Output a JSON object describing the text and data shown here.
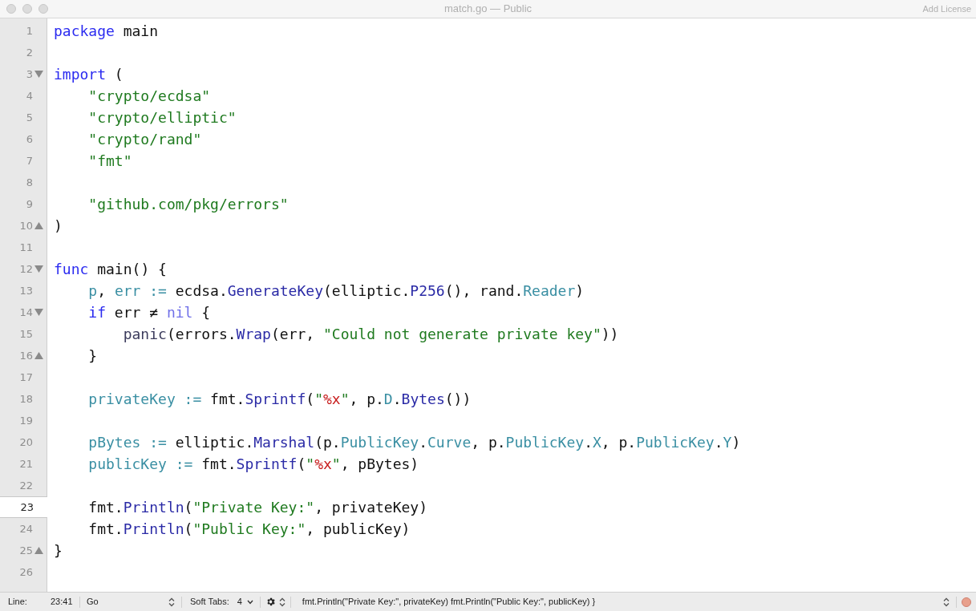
{
  "window": {
    "title": "match.go — Public",
    "action": "Add License"
  },
  "editor": {
    "lines": [
      {
        "number": "1",
        "fold_start": false,
        "fold_end": false,
        "current": false,
        "tokens": [
          {
            "kind": "keyword",
            "text": "package"
          },
          {
            "kind": "plain",
            "text": " main"
          }
        ]
      },
      {
        "number": "2",
        "fold_start": false,
        "fold_end": false,
        "current": false
      },
      {
        "number": "3",
        "fold_start": true,
        "fold_end": false,
        "current": false,
        "tokens": [
          {
            "kind": "keyword",
            "text": "import"
          },
          {
            "kind": "plain",
            "text": " ("
          }
        ]
      },
      {
        "number": "4",
        "fold_start": false,
        "fold_end": false,
        "current": false,
        "tokens": [
          {
            "kind": "string",
            "text": "    \"crypto/ecdsa\""
          }
        ]
      },
      {
        "number": "5",
        "fold_start": false,
        "fold_end": false,
        "current": false,
        "tokens": [
          {
            "kind": "string",
            "text": "    \"crypto/elliptic\""
          }
        ]
      },
      {
        "number": "6",
        "fold_start": false,
        "fold_end": false,
        "current": false,
        "tokens": [
          {
            "kind": "string",
            "text": "    \"crypto/rand\""
          }
        ]
      },
      {
        "number": "7",
        "fold_start": false,
        "fold_end": false,
        "current": false,
        "tokens": [
          {
            "kind": "string",
            "text": "    \"fmt\""
          }
        ]
      },
      {
        "number": "8",
        "fold_start": false,
        "fold_end": false,
        "current": false
      },
      {
        "number": "9",
        "fold_start": false,
        "fold_end": false,
        "current": false,
        "tokens": [
          {
            "kind": "string",
            "text": "    \"github.com/pkg/errors\""
          }
        ]
      },
      {
        "number": "10",
        "fold_start": false,
        "fold_end": true,
        "current": false,
        "tokens": [
          {
            "kind": "plain",
            "text": ")"
          }
        ]
      },
      {
        "number": "11",
        "fold_start": false,
        "fold_end": false,
        "current": false
      },
      {
        "number": "12",
        "fold_start": true,
        "fold_end": false,
        "current": false,
        "tokens": [
          {
            "kind": "keyword",
            "text": "func"
          },
          {
            "kind": "plain",
            "text": " main() {"
          }
        ]
      },
      {
        "number": "13",
        "fold_start": false,
        "fold_end": false,
        "current": false,
        "tokens": [
          {
            "kind": "variable",
            "text": "    p"
          },
          {
            "kind": "plain",
            "text": ", "
          },
          {
            "kind": "variable",
            "text": "err :="
          },
          {
            "kind": "plain",
            "text": " ecdsa."
          },
          {
            "kind": "method",
            "text": "GenerateKey"
          },
          {
            "kind": "plain",
            "text": "(elliptic."
          },
          {
            "kind": "method",
            "text": "P256"
          },
          {
            "kind": "plain",
            "text": "(), rand."
          },
          {
            "kind": "field",
            "text": "Reader"
          },
          {
            "kind": "plain",
            "text": ")"
          }
        ]
      },
      {
        "number": "14",
        "fold_start": true,
        "fold_end": false,
        "current": false,
        "tokens": [
          {
            "kind": "keyword",
            "text": "    if"
          },
          {
            "kind": "plain",
            "text": " err ≠ "
          },
          {
            "kind": "constant",
            "text": "nil"
          },
          {
            "kind": "plain",
            "text": " {"
          }
        ]
      },
      {
        "number": "15",
        "fold_start": false,
        "fold_end": false,
        "current": false,
        "tokens": [
          {
            "kind": "builtin",
            "text": "        panic"
          },
          {
            "kind": "plain",
            "text": "(errors."
          },
          {
            "kind": "method",
            "text": "Wrap"
          },
          {
            "kind": "plain",
            "text": "(err, "
          },
          {
            "kind": "string",
            "text": "\"Could not generate private key\""
          },
          {
            "kind": "plain",
            "text": "))"
          }
        ]
      },
      {
        "number": "16",
        "fold_start": false,
        "fold_end": true,
        "current": false,
        "tokens": [
          {
            "kind": "plain",
            "text": "    }"
          }
        ]
      },
      {
        "number": "17",
        "fold_start": false,
        "fold_end": false,
        "current": false
      },
      {
        "number": "18",
        "fold_start": false,
        "fold_end": false,
        "current": false,
        "tokens": [
          {
            "kind": "variable",
            "text": "    privateKey :="
          },
          {
            "kind": "plain",
            "text": " fmt."
          },
          {
            "kind": "method",
            "text": "Sprintf"
          },
          {
            "kind": "plain",
            "text": "("
          },
          {
            "kind": "string",
            "text": "\""
          },
          {
            "kind": "format",
            "text": "%x"
          },
          {
            "kind": "string",
            "text": "\""
          },
          {
            "kind": "plain",
            "text": ", p."
          },
          {
            "kind": "field",
            "text": "D"
          },
          {
            "kind": "plain",
            "text": "."
          },
          {
            "kind": "method",
            "text": "Bytes"
          },
          {
            "kind": "plain",
            "text": "())"
          }
        ]
      },
      {
        "number": "19",
        "fold_start": false,
        "fold_end": false,
        "current": false
      },
      {
        "number": "20",
        "fold_start": false,
        "fold_end": false,
        "current": false,
        "tokens": [
          {
            "kind": "variable",
            "text": "    pBytes :="
          },
          {
            "kind": "plain",
            "text": " elliptic."
          },
          {
            "kind": "method",
            "text": "Marshal"
          },
          {
            "kind": "plain",
            "text": "(p."
          },
          {
            "kind": "field",
            "text": "PublicKey"
          },
          {
            "kind": "plain",
            "text": "."
          },
          {
            "kind": "field",
            "text": "Curve"
          },
          {
            "kind": "plain",
            "text": ", p."
          },
          {
            "kind": "field",
            "text": "PublicKey"
          },
          {
            "kind": "plain",
            "text": "."
          },
          {
            "kind": "field",
            "text": "X"
          },
          {
            "kind": "plain",
            "text": ", p."
          },
          {
            "kind": "field",
            "text": "PublicKey"
          },
          {
            "kind": "plain",
            "text": "."
          },
          {
            "kind": "field",
            "text": "Y"
          },
          {
            "kind": "plain",
            "text": ")"
          }
        ]
      },
      {
        "number": "21",
        "fold_start": false,
        "fold_end": false,
        "current": false,
        "tokens": [
          {
            "kind": "variable",
            "text": "    publicKey :="
          },
          {
            "kind": "plain",
            "text": " fmt."
          },
          {
            "kind": "method",
            "text": "Sprintf"
          },
          {
            "kind": "plain",
            "text": "("
          },
          {
            "kind": "string",
            "text": "\""
          },
          {
            "kind": "format",
            "text": "%x"
          },
          {
            "kind": "string",
            "text": "\""
          },
          {
            "kind": "plain",
            "text": ", pBytes)"
          }
        ]
      },
      {
        "number": "22",
        "fold_start": false,
        "fold_end": false,
        "current": false
      },
      {
        "number": "23",
        "fold_start": false,
        "fold_end": false,
        "current": true,
        "tokens": [
          {
            "kind": "plain",
            "text": "    fmt."
          },
          {
            "kind": "method",
            "text": "Println"
          },
          {
            "kind": "plain",
            "text": "("
          },
          {
            "kind": "string",
            "text": "\"Private Key:\""
          },
          {
            "kind": "plain",
            "text": ", privateKey)"
          }
        ]
      },
      {
        "number": "24",
        "fold_start": false,
        "fold_end": false,
        "current": false,
        "tokens": [
          {
            "kind": "plain",
            "text": "    fmt."
          },
          {
            "kind": "method",
            "text": "Println"
          },
          {
            "kind": "plain",
            "text": "("
          },
          {
            "kind": "string",
            "text": "\"Public Key:\""
          },
          {
            "kind": "plain",
            "text": ", publicKey)"
          }
        ]
      },
      {
        "number": "25",
        "fold_start": false,
        "fold_end": true,
        "current": false,
        "tokens": [
          {
            "kind": "plain",
            "text": "}"
          }
        ]
      },
      {
        "number": "26",
        "fold_start": false,
        "fold_end": false,
        "current": false
      }
    ]
  },
  "status_bar": {
    "line_label": "Line:",
    "position": "23:41",
    "syntax": "Go",
    "tabs_label": "Soft Tabs:",
    "tab_size": "4",
    "symbol": "fmt.Println(\"Private Key:\", privateKey) fmt.Println(\"Public Key:\", publicKey) }"
  }
}
